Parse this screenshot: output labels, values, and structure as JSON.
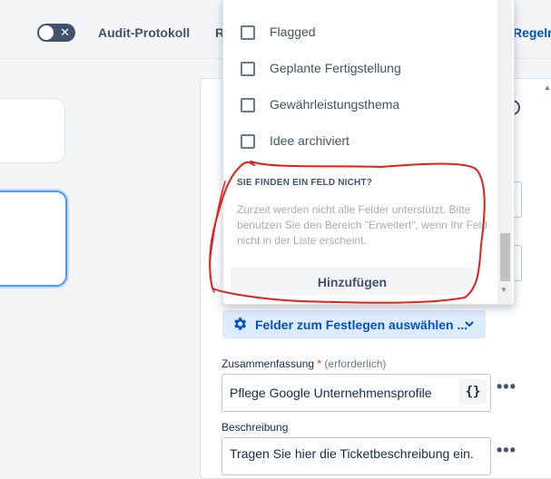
{
  "header": {
    "toggle_glyph": "✕",
    "audit_label": "Audit-Protokoll",
    "cut_label": "R",
    "rules_label": "Regeln"
  },
  "dropdown": {
    "options": [
      {
        "label": "Flagged",
        "checked": false
      },
      {
        "label": "Geplante Fertigstellung",
        "checked": false
      },
      {
        "label": "Gewährleistungsthema",
        "checked": false
      },
      {
        "label": "Idee archiviert",
        "checked": false
      }
    ],
    "hint_heading": "SIE FINDEN EIN FELD NICHT?",
    "hint_text": "Zurzeit werden nicht alle Felder unterstützt. Bitte benutzen Sie den Bereich \"Erweitert\", wenn Ihr Feld nicht in der Liste erscheint.",
    "add_button": "Hinzufügen"
  },
  "panel": {
    "field_select_label": "Felder zum Festlegen auswählen ...",
    "summary": {
      "label": "Zusammenfassung",
      "required_marker": "*",
      "required_text": "(erforderlich)",
      "value": "Pflege Google Unternehmensprofile",
      "braces": "{}",
      "more": "•••"
    },
    "description": {
      "label": "Beschreibung",
      "value": "Tragen Sie hier die Ticketbeschreibung ein.",
      "more": "•••"
    }
  },
  "colors": {
    "accent": "#0052cc",
    "select_bg": "#deebff",
    "annotation": "#e0201b",
    "focus": "#4c9aff"
  }
}
